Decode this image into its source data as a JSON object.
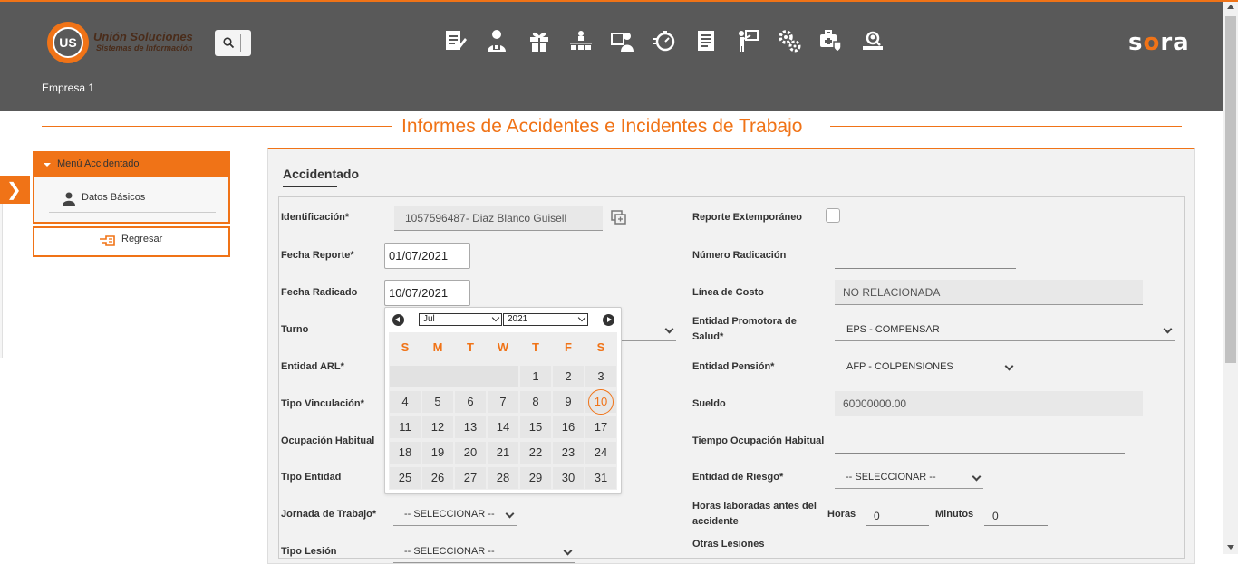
{
  "header": {
    "logo_mark": "US",
    "logo_title": "Unión Soluciones",
    "logo_subtitle": "Sistemas de Información",
    "brand_prefix": "s",
    "brand_o": "o",
    "brand_suffix": "ra",
    "company": "Empresa 1",
    "nav_icons": [
      "report-edit-icon",
      "user-accident-icon",
      "gift-icon",
      "org-hierarchy-icon",
      "user-card-icon",
      "timer-icon",
      "document-list-icon",
      "presentation-icon",
      "gears-icon",
      "medical-shield-icon",
      "inspection-icon"
    ]
  },
  "page": {
    "title": "Informes de Accidentes e Incidentes de Trabajo"
  },
  "sidebar": {
    "menu_title": "Menú Accidentado",
    "items": [
      {
        "label": "Datos Básicos"
      }
    ],
    "back_label": "Regresar"
  },
  "panel": {
    "title": "Accidentado"
  },
  "form": {
    "identificacion_label": "Identificación*",
    "identificacion_value": "1057596487- Diaz Blanco Guisell",
    "fecha_reporte_label": "Fecha Reporte*",
    "fecha_reporte_value": "01/07/2021",
    "fecha_radicado_label": "Fecha Radicado",
    "fecha_radicado_value": "10/07/2021",
    "turno_label": "Turno",
    "entidad_arl_label": "Entidad ARL*",
    "tipo_vinculacion_label": "Tipo Vinculación*",
    "ocupacion_label": "Ocupación Habitual",
    "tipo_entidad_label": "Tipo Entidad",
    "jornada_label": "Jornada de Trabajo*",
    "jornada_value": "-- SELECCIONAR --",
    "tipo_lesion_label": "Tipo Lesión",
    "tipo_lesion_value": "-- SELECCIONAR --",
    "reporte_ext_label": "Reporte Extemporáneo",
    "numero_radicacion_label": "Número Radicación",
    "linea_costo_label": "Línea de Costo",
    "linea_costo_value": "NO RELACIONADA",
    "eps_label": "Entidad Promotora de Salud*",
    "eps_value": "EPS - COMPENSAR",
    "pension_label": "Entidad Pensión*",
    "pension_value": "AFP - COLPENSIONES",
    "sueldo_label": "Sueldo",
    "sueldo_value": "60000000.00",
    "tiempo_ocup_label": "Tiempo Ocupación Habitual",
    "entidad_riesgo_label": "Entidad de Riesgo*",
    "entidad_riesgo_value": "-- SELECCIONAR --",
    "horas_antes_label": "Horas laboradas antes del accidente",
    "horas_label": "Horas",
    "horas_value": "0",
    "minutos_label": "Minutos",
    "minutos_value": "0",
    "otras_lesiones_label": "Otras Lesiones"
  },
  "calendar": {
    "month": "Jul",
    "year": "2021",
    "weekdays": [
      "S",
      "M",
      "T",
      "W",
      "T",
      "F",
      "S"
    ],
    "selected_day": "10",
    "days": [
      "1",
      "2",
      "3",
      "4",
      "5",
      "6",
      "7",
      "8",
      "9",
      "10",
      "11",
      "12",
      "13",
      "14",
      "15",
      "16",
      "17",
      "18",
      "19",
      "20",
      "21",
      "22",
      "23",
      "24",
      "25",
      "26",
      "27",
      "28",
      "29",
      "30",
      "31"
    ]
  },
  "colors": {
    "accent": "#f07317",
    "header_bg": "#595959"
  }
}
